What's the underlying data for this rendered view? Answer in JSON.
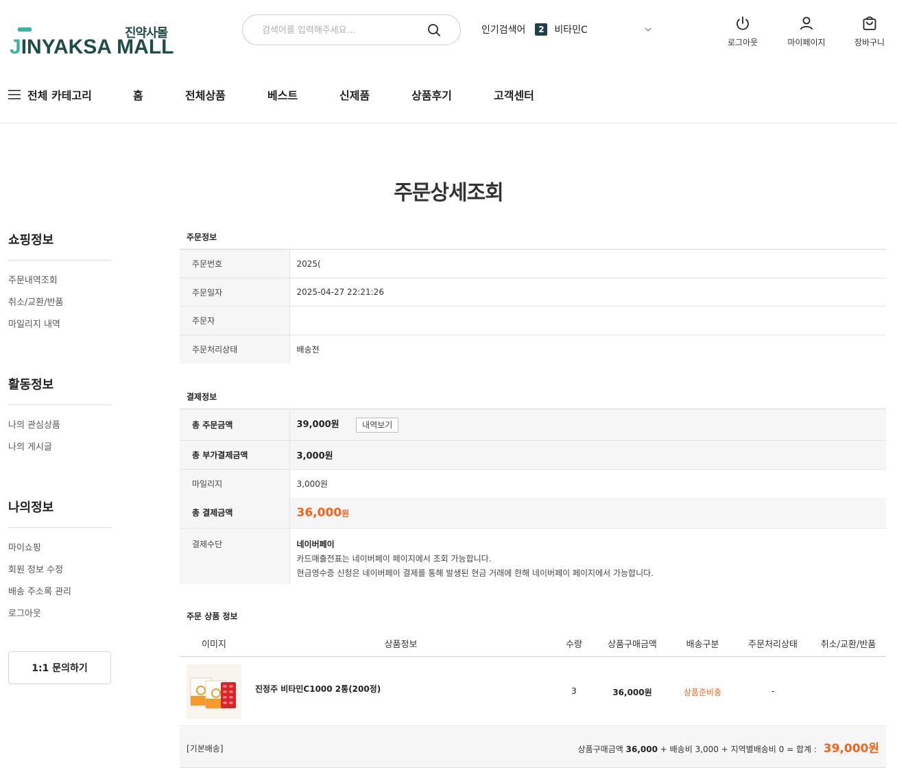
{
  "header": {
    "logo_kor": "진약사몰",
    "logo_j": "J",
    "logo_eng": "INYAKSA MALL",
    "search_placeholder": "검색어를 입력해주세요...",
    "popular_label": "인기검색어",
    "popular_rank": "2",
    "popular_term": "비타민C",
    "util": {
      "logout": "로그아웃",
      "mypage": "마이페이지",
      "cart": "장바구니"
    }
  },
  "nav": {
    "all_category": "전체 카테고리",
    "items": [
      "홈",
      "전체상품",
      "베스트",
      "신제품",
      "상품후기",
      "고객센터"
    ]
  },
  "page_title": "주문상세조회",
  "sidebar": {
    "shopping": {
      "title": "쇼핑정보",
      "links": [
        "주문내역조회",
        "취소/교환/반품",
        "마일리지 내역"
      ]
    },
    "activity": {
      "title": "활동정보",
      "links": [
        "나의 관심상품",
        "나의 게시글"
      ]
    },
    "myinfo": {
      "title": "나의정보",
      "links": [
        "마이쇼핑",
        "회원 정보 수정",
        "배송 주소록 관리",
        "로그아웃"
      ]
    },
    "inquiry_button": "1:1 문의하기"
  },
  "order_info": {
    "title": "주문정보",
    "rows": [
      {
        "label": "주문번호",
        "value": "2025("
      },
      {
        "label": "주문일자",
        "value": "2025-04-27 22:21:26"
      },
      {
        "label": "주문자",
        "value": ""
      },
      {
        "label": "주문처리상태",
        "value": "배송전"
      }
    ]
  },
  "payment_info": {
    "title": "결제정보",
    "total_order_label": "총 주문금액",
    "total_order_value": "39,000원",
    "detail_button": "내역보기",
    "total_extra_label": "총 부가결제금액",
    "total_extra_value": "3,000원",
    "mileage_label": "마일리지",
    "mileage_value": "3,000원",
    "total_pay_label": "총 결제금액",
    "total_pay_number": "36,000",
    "total_pay_unit": "원",
    "method_label": "결제수단",
    "method_name": "네이버페이",
    "method_note1": "카드매출전표는 네이버페이 페이지에서 조회 가능합니다.",
    "method_note2": "현금영수증 신청은 네이버페이 결제를 통해 발생된 현금 거래에 한해 네이버페이 페이지에서 가능합니다."
  },
  "products": {
    "title": "주문 상품 정보",
    "headers": [
      "이미지",
      "상품정보",
      "수량",
      "상품구매금액",
      "배송구분",
      "주문처리상태",
      "취소/교환/반품"
    ],
    "row": {
      "name": "진정주 비타민C1000 2통(200정)",
      "qty": "3",
      "price": "36,000원",
      "ship_type": "",
      "status": "상품준비중",
      "cancel": "-"
    },
    "footer": {
      "ship_label": "[기본배송]",
      "sum_prefix": "상품구매금액",
      "sum_amount": "36,000",
      "sum_middle": "+ 배송비 3,000 + 지역별배송비 0 = 합계 :",
      "grand_total": "39,000원"
    }
  },
  "colors": {
    "brand": "#1f4d45",
    "accent": "#f1651b"
  }
}
